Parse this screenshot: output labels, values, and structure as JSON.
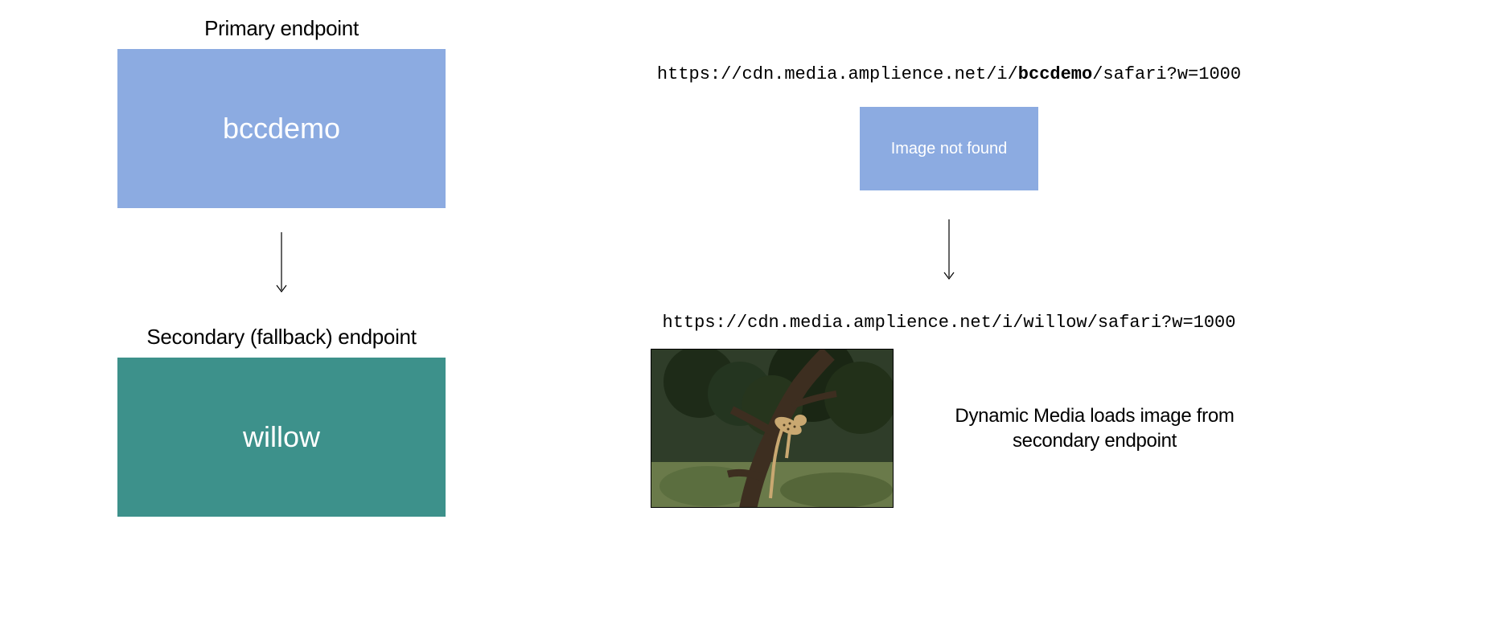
{
  "left": {
    "primary_label": "Primary endpoint",
    "primary_name": "bccdemo",
    "secondary_label": "Secondary (fallback) endpoint",
    "secondary_name": "willow"
  },
  "right": {
    "url1_prefix": "https://cdn.media.amplience.net/i/",
    "url1_bold": "bccdemo",
    "url1_suffix": "/safari?w=1000",
    "notfound_text": "Image not found",
    "url2_prefix": "https://cdn.media.amplience.net/i/",
    "url2_bold": "willow",
    "url2_suffix": "/safari?w=1000",
    "caption": "Dynamic Media loads image from secondary endpoint"
  },
  "colors": {
    "primary_box": "#8cabe1",
    "secondary_box": "#3d918b",
    "notfound_box": "#8cabe1"
  }
}
